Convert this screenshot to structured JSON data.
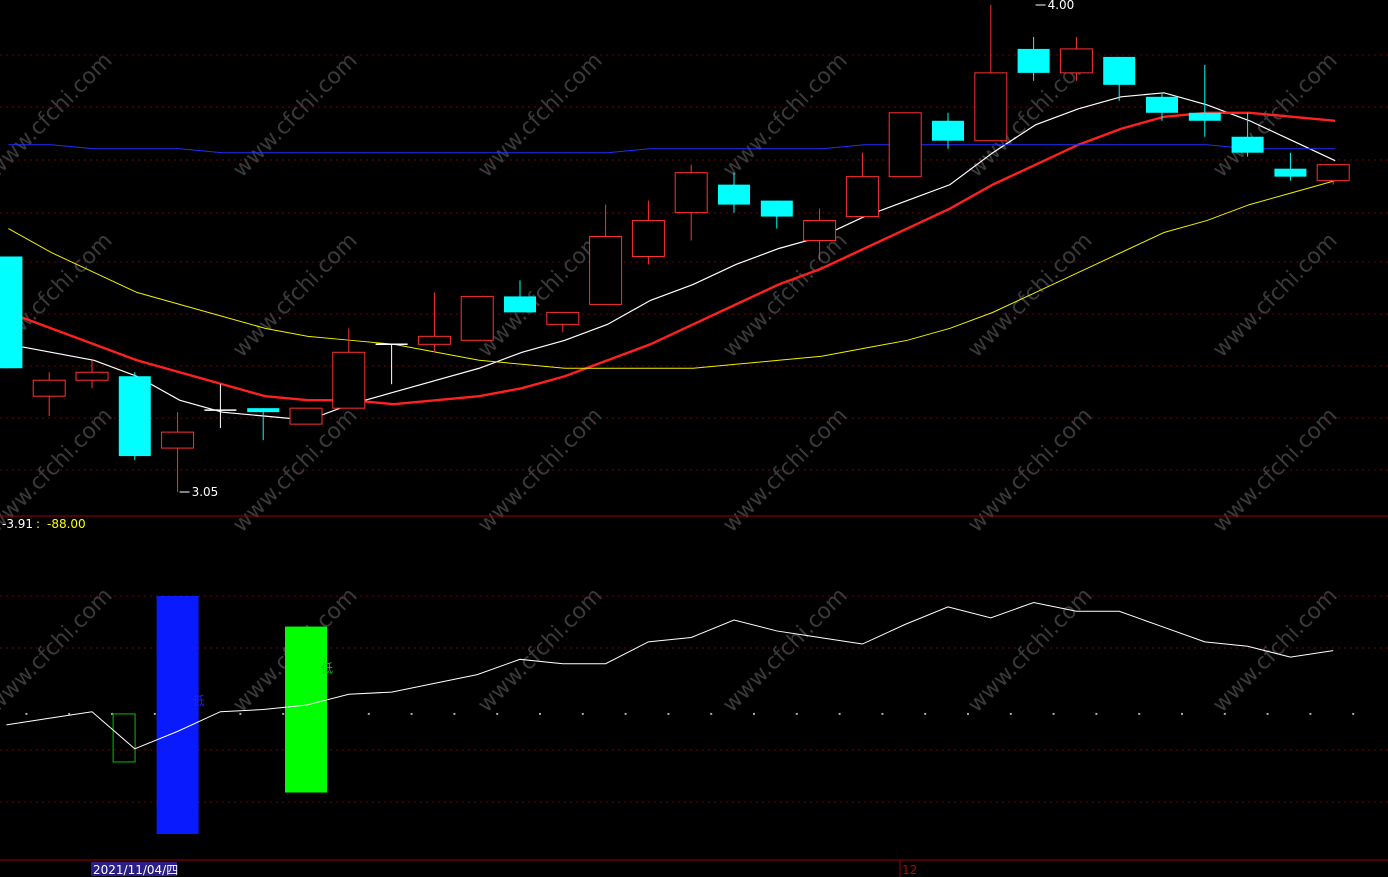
{
  "chart_data": [
    {
      "type": "candlestick",
      "panel": "price",
      "price_range": [
        2.6,
        4.0
      ],
      "grid": true,
      "watermark": "www.cfchi.com",
      "candles": [
        {
          "o": 3.64,
          "c": 3.36,
          "h": 3.64,
          "l": 3.36,
          "dir": "down"
        },
        {
          "o": 3.29,
          "c": 3.33,
          "h": 3.35,
          "l": 3.24,
          "dir": "up"
        },
        {
          "o": 3.33,
          "c": 3.35,
          "h": 3.38,
          "l": 3.31,
          "dir": "up"
        },
        {
          "o": 3.34,
          "c": 3.14,
          "h": 3.35,
          "l": 3.13,
          "dir": "down"
        },
        {
          "o": 3.16,
          "c": 3.2,
          "h": 3.25,
          "l": 3.05,
          "dir": "up"
        },
        {
          "o": 3.255,
          "c": 3.255,
          "h": 3.32,
          "l": 3.21,
          "dir": "doji"
        },
        {
          "o": 3.26,
          "c": 3.25,
          "h": 3.26,
          "l": 3.18,
          "dir": "down"
        },
        {
          "o": 3.22,
          "c": 3.26,
          "h": 3.26,
          "l": 3.22,
          "dir": "up"
        },
        {
          "o": 3.26,
          "c": 3.4,
          "h": 3.46,
          "l": 3.26,
          "dir": "up"
        },
        {
          "o": 3.42,
          "c": 3.42,
          "h": 3.42,
          "l": 3.32,
          "dir": "doji"
        },
        {
          "o": 3.42,
          "c": 3.44,
          "h": 3.55,
          "l": 3.4,
          "dir": "up"
        },
        {
          "o": 3.43,
          "c": 3.54,
          "h": 3.54,
          "l": 3.43,
          "dir": "up"
        },
        {
          "o": 3.54,
          "c": 3.5,
          "h": 3.58,
          "l": 3.5,
          "dir": "down"
        },
        {
          "o": 3.47,
          "c": 3.5,
          "h": 3.5,
          "l": 3.45,
          "dir": "up"
        },
        {
          "o": 3.52,
          "c": 3.69,
          "h": 3.77,
          "l": 3.52,
          "dir": "up"
        },
        {
          "o": 3.64,
          "c": 3.73,
          "h": 3.78,
          "l": 3.62,
          "dir": "up"
        },
        {
          "o": 3.75,
          "c": 3.85,
          "h": 3.87,
          "l": 3.68,
          "dir": "up"
        },
        {
          "o": 3.82,
          "c": 3.77,
          "h": 3.85,
          "l": 3.75,
          "dir": "down"
        },
        {
          "o": 3.78,
          "c": 3.74,
          "h": 3.78,
          "l": 3.71,
          "dir": "down"
        },
        {
          "o": 3.68,
          "c": 3.73,
          "h": 3.76,
          "l": 3.63,
          "dir": "up"
        },
        {
          "o": 3.74,
          "c": 3.84,
          "h": 3.9,
          "l": 3.74,
          "dir": "up"
        },
        {
          "o": 3.84,
          "c": 4.0,
          "h": 4.0,
          "l": 3.84,
          "dir": "up"
        },
        {
          "o": 3.98,
          "c": 3.93,
          "h": 4.0,
          "l": 3.91,
          "dir": "down"
        },
        {
          "o": 3.93,
          "c": 4.1,
          "h": 4.27,
          "l": 3.93,
          "dir": "up"
        },
        {
          "o": 4.16,
          "c": 4.1,
          "h": 4.19,
          "l": 4.08,
          "dir": "down"
        },
        {
          "o": 4.1,
          "c": 4.16,
          "h": 4.19,
          "l": 4.08,
          "dir": "up"
        },
        {
          "o": 4.14,
          "c": 4.07,
          "h": 4.14,
          "l": 4.03,
          "dir": "down"
        },
        {
          "o": 4.04,
          "c": 4.0,
          "h": 4.05,
          "l": 3.98,
          "dir": "down"
        },
        {
          "o": 4.0,
          "c": 3.98,
          "h": 4.12,
          "l": 3.94,
          "dir": "down"
        },
        {
          "o": 3.94,
          "c": 3.9,
          "h": 4.0,
          "l": 3.89,
          "dir": "down"
        },
        {
          "o": 3.86,
          "c": 3.84,
          "h": 3.9,
          "l": 3.83,
          "dir": "down"
        },
        {
          "o": 3.83,
          "c": 3.87,
          "h": 3.87,
          "l": 3.82,
          "dir": "up"
        }
      ],
      "moving_averages": [
        {
          "color": "#ffffff",
          "width": 1.2,
          "values": [
            3.42,
            3.4,
            3.38,
            3.34,
            3.28,
            3.25,
            3.24,
            3.23,
            3.27,
            3.3,
            3.33,
            3.36,
            3.4,
            3.43,
            3.47,
            3.53,
            3.57,
            3.62,
            3.66,
            3.69,
            3.74,
            3.78,
            3.82,
            3.9,
            3.97,
            4.01,
            4.04,
            4.05,
            4.02,
            3.98,
            3.93,
            3.88
          ]
        },
        {
          "color": "#ff2020",
          "width": 2.4,
          "values": [
            3.5,
            3.46,
            3.42,
            3.38,
            3.35,
            3.32,
            3.29,
            3.28,
            3.28,
            3.27,
            3.28,
            3.29,
            3.31,
            3.34,
            3.38,
            3.42,
            3.47,
            3.52,
            3.57,
            3.61,
            3.66,
            3.71,
            3.76,
            3.82,
            3.87,
            3.92,
            3.96,
            3.99,
            4.0,
            4.0,
            3.99,
            3.98
          ]
        },
        {
          "color": "#f0f000",
          "width": 1.0,
          "values": [
            3.71,
            3.65,
            3.6,
            3.55,
            3.52,
            3.49,
            3.46,
            3.44,
            3.43,
            3.42,
            3.4,
            3.38,
            3.37,
            3.36,
            3.36,
            3.36,
            3.36,
            3.37,
            3.38,
            3.39,
            3.41,
            3.43,
            3.46,
            3.5,
            3.55,
            3.6,
            3.65,
            3.7,
            3.73,
            3.77,
            3.8,
            3.83
          ]
        },
        {
          "color": "#2030ff",
          "width": 1.0,
          "values": [
            3.92,
            3.92,
            3.91,
            3.91,
            3.91,
            3.9,
            3.9,
            3.9,
            3.9,
            3.9,
            3.9,
            3.9,
            3.9,
            3.9,
            3.9,
            3.91,
            3.91,
            3.91,
            3.91,
            3.91,
            3.92,
            3.92,
            3.92,
            3.92,
            3.92,
            3.92,
            3.92,
            3.92,
            3.92,
            3.91,
            3.91,
            3.91
          ]
        }
      ],
      "annotations": [
        {
          "text": "4.00",
          "index": 24,
          "price": 4.27,
          "kind": "high"
        },
        {
          "text": "3.05",
          "index": 4,
          "price": 3.05,
          "kind": "low"
        }
      ]
    },
    {
      "type": "line",
      "panel": "indicator",
      "y_range": [
        -120,
        0
      ],
      "header_value_1": "-3.91",
      "header_separator": ":",
      "header_value_2": "-88.00",
      "header_color_1": "#ffffff",
      "header_color_2": "#ffff00",
      "grid": true,
      "reference_dotted_level": -88,
      "line_color": "#ffffff",
      "values": [
        -93,
        -90,
        -87,
        -104,
        -96,
        -87,
        -86,
        -84,
        -79,
        -78,
        -74,
        -70,
        -63,
        -65,
        -65,
        -55,
        -53,
        -45,
        -50,
        -53,
        -56,
        -47,
        -39,
        -44,
        -37,
        -41,
        -41,
        -48,
        -55,
        -57,
        -62,
        -59
      ],
      "bars": [
        {
          "index": 2.75,
          "top": -88,
          "bottom": -110,
          "color": "#00c000",
          "filled": false
        },
        {
          "index": 4,
          "top": -34,
          "bottom": -143,
          "color": "#0a1aff",
          "filled": true
        },
        {
          "index": 7,
          "top": -48,
          "bottom": -124,
          "color": "#00ff00",
          "filled": true
        }
      ],
      "bar_labels": [
        {
          "text": "低",
          "index": 4.35,
          "value": -84,
          "color": "#2020ff"
        },
        {
          "text": "低",
          "index": 7.35,
          "value": -69,
          "color": "#00d000"
        }
      ]
    }
  ],
  "x_axis": {
    "date_label": "2021/11/04/四",
    "month_label": "12"
  }
}
